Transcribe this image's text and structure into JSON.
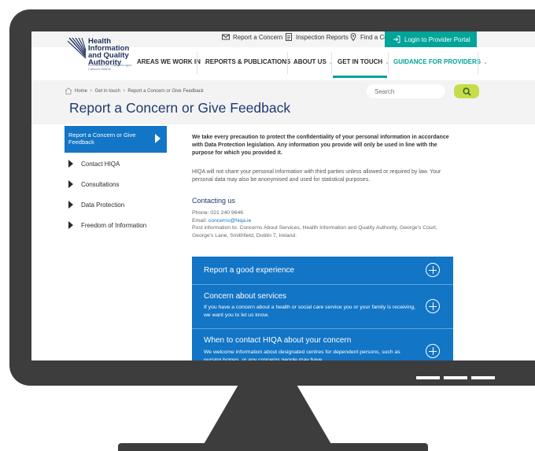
{
  "utility": {
    "report": "Report a Concern",
    "inspection": "Inspection Reports",
    "find": "Find a Centre",
    "login": "Login to Provider Portal"
  },
  "logo": {
    "line1": "Health",
    "line2": "Information",
    "line3": "and Quality",
    "line4": "Authority",
    "sub": "An tÚdarás Um Fhaisnéis agus Cáilíocht Sláinte"
  },
  "nav": {
    "areas": "AREAS WE WORK IN",
    "reports": "REPORTS & PUBLICATIONS",
    "about": "ABOUT US",
    "touch": "GET IN TOUCH",
    "guidance": "GUIDANCE FOR PROVIDERS"
  },
  "breadcrumb": {
    "home": "Home",
    "touch": "Get in touch",
    "current": "Report a Concern or Give Feedback"
  },
  "page": {
    "title": "Report a Concern or Give Feedback"
  },
  "search": {
    "placeholder": "Search"
  },
  "side": {
    "active": "Report a Concern or Give Feedback",
    "items": [
      "Contact HIQA",
      "Consultations",
      "Data Protection",
      "Freedom of Information"
    ]
  },
  "content": {
    "intro_bold": "We take every precaution to protect the confidentiality of your personal information in accordance with Data Protection legislation. Any information you provide will only be used in line with the purpose for which you provided it.",
    "intro": "HIQA will not share your personal information with third parties unless allowed or required by law. Your personal data may also be anonymised and used for statistical purposes.",
    "contact_heading": "Contacting us",
    "phone": "Phone: 021 240 9646",
    "email_label": "Email: ",
    "email": "concerns@hiqa.ie",
    "post": "Post information to: Concerns About Services, Health Information and Quality Authority, George's Court, George's Lane, Smithfield, Dublin 7, Ireland."
  },
  "accordions": [
    {
      "title": "Report a good experience",
      "desc": ""
    },
    {
      "title": "Concern about services",
      "desc": "If you have a concern about a health or social care service you or your family is receiving, we want you to let us know."
    },
    {
      "title": "When to contact HIQA about your concern",
      "desc": "We welcome information about designated centres for dependent persons, such as nursing homes, or any concerns people may have."
    }
  ],
  "colors": {
    "accent": "#00a499",
    "blue": "#1275c6",
    "title": "#1d3a70",
    "lime": "#c8dc4a",
    "bezel": "#3d3d3d"
  }
}
